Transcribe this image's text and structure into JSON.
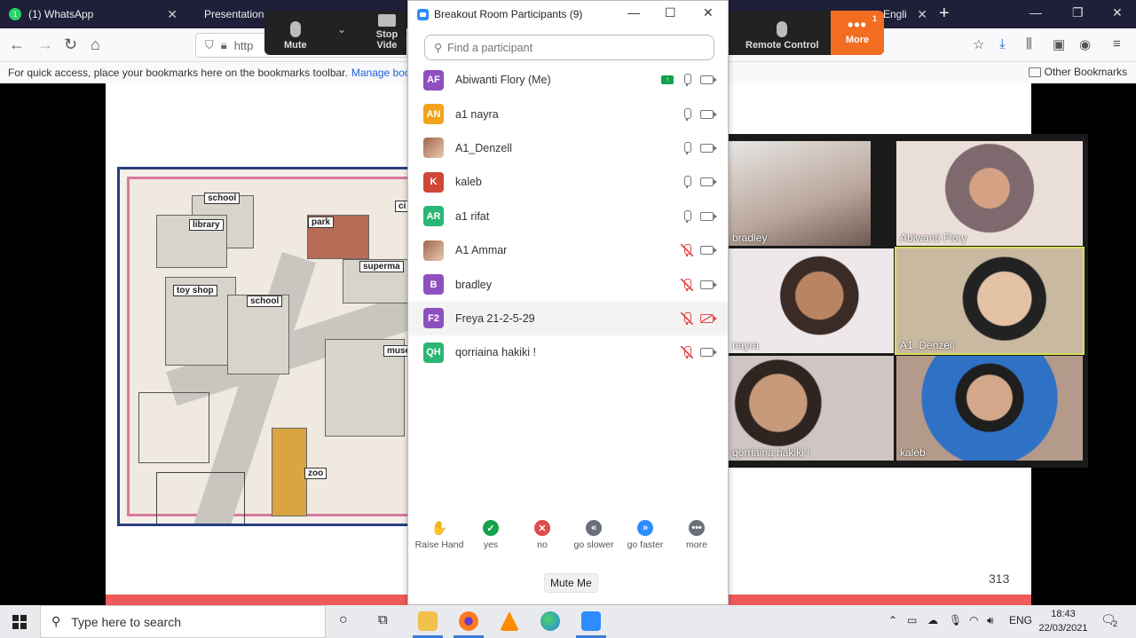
{
  "browser": {
    "tabs": [
      {
        "title": "(1) WhatsApp",
        "badge": "1"
      },
      {
        "title": "Presentation"
      },
      {
        "title": "Engli"
      }
    ],
    "url_prefix": "http",
    "bookmarks_hint": "For quick access, place your bookmarks here on the bookmarks toolbar.",
    "manage_bookmarks": "Manage bookmark",
    "other_bookmarks": "Other Bookmarks"
  },
  "zoom_toolbar": {
    "mute": "Mute",
    "stop_video": "Stop Vide",
    "remote_control": "Remote Control",
    "more": "More",
    "more_badge": "1"
  },
  "slide": {
    "map_labels": [
      "school",
      "library",
      "park",
      "ci",
      "superma",
      "toy shop",
      "school",
      "muse",
      "zoo"
    ],
    "page_number": "313"
  },
  "participants_window": {
    "title": "Breakout Room Participants (9)",
    "search_placeholder": "Find a participant",
    "participants": [
      {
        "initials": "AF",
        "name": "Abiwanti Flory (Me)",
        "color": "#8e4fbf",
        "sharing": true,
        "mic_muted": false,
        "video_off": false
      },
      {
        "initials": "AN",
        "name": "a1 nayra",
        "color": "#f3a21b",
        "mic_muted": false,
        "video_off": false
      },
      {
        "initials": "",
        "name": "A1_Denzell",
        "color": "#a0674a",
        "photo": true,
        "mic_muted": false,
        "video_off": false
      },
      {
        "initials": "K",
        "name": "kaleb",
        "color": "#d04637",
        "mic_muted": false,
        "video_off": false
      },
      {
        "initials": "AR",
        "name": "a1 rifat",
        "color": "#2bb673",
        "mic_muted": false,
        "video_off": false
      },
      {
        "initials": "",
        "name": "A1 Ammar",
        "color": "#555555",
        "photo": true,
        "mic_muted": true,
        "video_off": false
      },
      {
        "initials": "B",
        "name": "bradley",
        "color": "#8e4fbf",
        "mic_muted": true,
        "video_off": false
      },
      {
        "initials": "F2",
        "name": "Freya 21-2-5-29",
        "color": "#8e4fbf",
        "mic_muted": true,
        "video_off": true
      },
      {
        "initials": "QH",
        "name": "qorriaina hakiki !",
        "color": "#2bb673",
        "mic_muted": true,
        "video_off": false
      }
    ],
    "reactions": [
      {
        "label": "Raise Hand",
        "icon": "hand-icon",
        "color": "#2d8cff",
        "glyph": "✋"
      },
      {
        "label": "yes",
        "icon": "check-icon",
        "color": "#14a24c",
        "glyph": "✓"
      },
      {
        "label": "no",
        "icon": "x-icon",
        "color": "#e04b4b",
        "glyph": "✕"
      },
      {
        "label": "go slower",
        "icon": "rewind-icon",
        "color": "#6b6f7a",
        "glyph": "«"
      },
      {
        "label": "go faster",
        "icon": "fast-forward-icon",
        "color": "#2d8cff",
        "glyph": "»"
      },
      {
        "label": "more",
        "icon": "more-icon",
        "color": "#6b6f7a",
        "glyph": "•••"
      }
    ],
    "mute_me": "Mute Me"
  },
  "gallery": {
    "tiles": [
      {
        "name": "bradley"
      },
      {
        "name": "Abiwanti Flory"
      },
      {
        "name": "nayra"
      },
      {
        "name": "A1_Denzell"
      },
      {
        "name": "qorriaina hakiki !"
      },
      {
        "name": "kaleb"
      }
    ]
  },
  "taskbar": {
    "search_placeholder": "Type here to search",
    "language": "ENG",
    "time": "18:43",
    "date": "22/03/2021",
    "notification_count": "2"
  }
}
